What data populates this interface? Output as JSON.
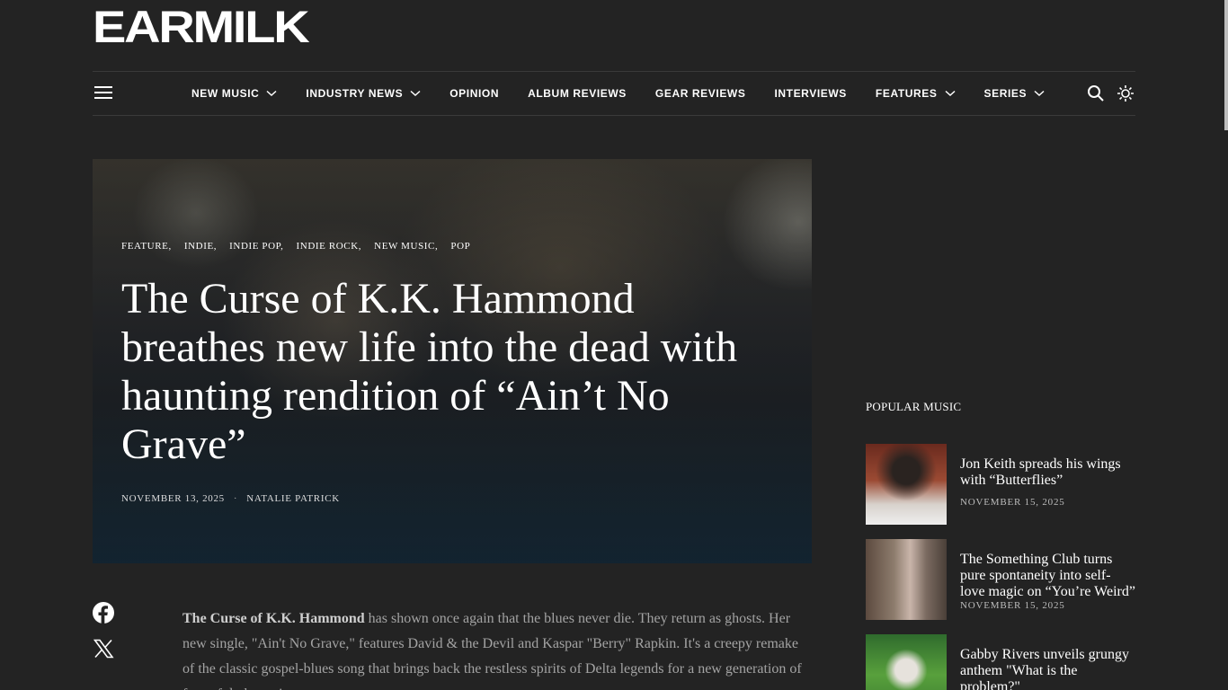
{
  "logo": "EARMILK",
  "nav": {
    "items": [
      {
        "label": "NEW MUSIC",
        "dropdown": true
      },
      {
        "label": "INDUSTRY NEWS",
        "dropdown": true
      },
      {
        "label": "OPINION",
        "dropdown": false
      },
      {
        "label": "ALBUM REVIEWS",
        "dropdown": false
      },
      {
        "label": "GEAR REVIEWS",
        "dropdown": false
      },
      {
        "label": "INTERVIEWS",
        "dropdown": false
      },
      {
        "label": "FEATURES",
        "dropdown": true
      },
      {
        "label": "SERIES",
        "dropdown": true
      }
    ],
    "icons": [
      "menu-icon",
      "search-icon",
      "sun-icon"
    ]
  },
  "hero": {
    "categories": [
      "FEATURE,",
      "INDIE,",
      "INDIE POP,",
      "INDIE ROCK,",
      "NEW MUSIC,",
      "POP"
    ],
    "title": "The Curse of K.K. Hammond breathes new life into the dead with haunting rendition of “Ain’t No Grave”",
    "date": "NOVEMBER 13, 2025",
    "separator": "·",
    "author": "NATALIE PATRICK"
  },
  "share": {
    "icons": [
      "facebook-icon",
      "x-icon"
    ]
  },
  "article": {
    "lead_bold": "The Curse of K.K. Hammond",
    "lead_rest": " has shown once again that the blues never die. They return as ghosts. Her new single, \"Ain't No Grave,\" features David & the Devil and Kaspar \"Berry\" Rapkin. It's a creepy remake of the classic gospel-blues song that brings back the restless spirits of Delta legends for a new generation of fans of dark music."
  },
  "sidebar": {
    "heading": "POPULAR MUSIC",
    "items": [
      {
        "title": "Jon Keith spreads his wings with “Butterflies”",
        "date": "NOVEMBER 15, 2025"
      },
      {
        "title": "The Something Club turns pure spontaneity into self-love magic on “You’re Weird”",
        "date": "NOVEMBER 15, 2025"
      },
      {
        "title": "Gabby Rivers unveils grungy anthem \"What is the problem?\"",
        "date": ""
      }
    ]
  },
  "colors": {
    "background": "#232323",
    "text": "#ffffff",
    "body_text": "#a3a3a3",
    "divider": "#3a3a3a"
  }
}
